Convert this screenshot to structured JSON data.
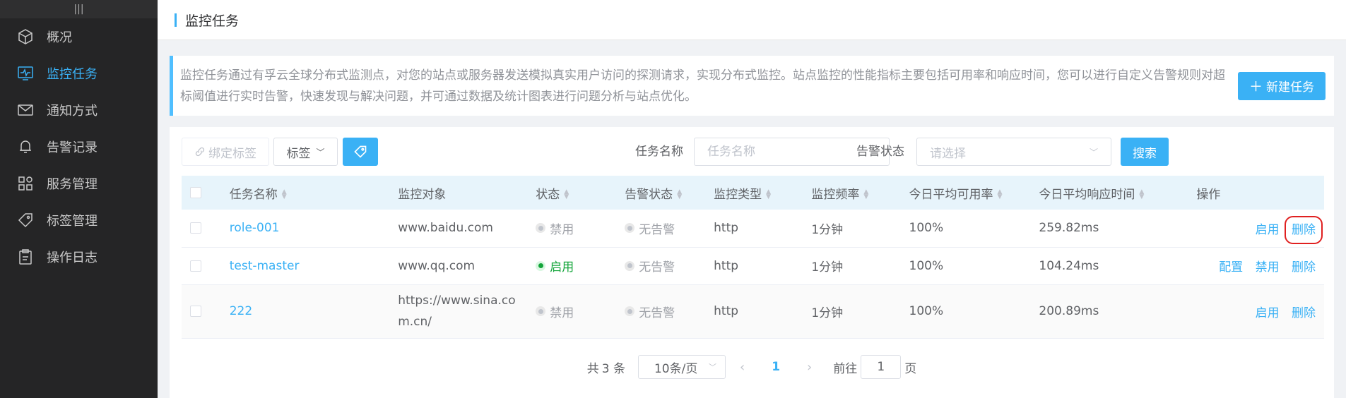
{
  "sidebar": {
    "toggle": "|||",
    "items": [
      {
        "label": "概况",
        "icon": "cube-icon",
        "active": false
      },
      {
        "label": "监控任务",
        "icon": "monitor-icon",
        "active": true
      },
      {
        "label": "通知方式",
        "icon": "envelope-icon",
        "active": false
      },
      {
        "label": "告警记录",
        "icon": "bell-icon",
        "active": false
      },
      {
        "label": "服务管理",
        "icon": "grid-icon",
        "active": false
      },
      {
        "label": "标签管理",
        "icon": "tag-icon",
        "active": false
      },
      {
        "label": "操作日志",
        "icon": "clipboard-icon",
        "active": false
      }
    ]
  },
  "header": {
    "title": "监控任务"
  },
  "notice": {
    "text": "监控任务通过有孚云全球分布式监测点，对您的站点或服务器发送模拟真实用户访问的探测请求，实现分布式监控。站点监控的性能指标主要包括可用率和响应时间，您可以进行自定义告警规则对超标阈值进行实时告警，快速发现与解决问题，并可通过数据及统计图表进行问题分析与站点优化。",
    "new_task_label": "新建任务"
  },
  "toolbar": {
    "bind_tag_label": "绑定标签",
    "tag_dropdown_label": "标签",
    "task_name_label": "任务名称",
    "task_name_placeholder": "任务名称",
    "alert_status_label": "告警状态",
    "alert_status_placeholder": "请选择",
    "search_label": "搜索"
  },
  "table": {
    "headers": [
      "任务名称",
      "监控对象",
      "状态",
      "告警状态",
      "监控类型",
      "监控频率",
      "今日平均可用率",
      "今日平均响应时间",
      "操作"
    ],
    "rows": [
      {
        "name": "role-001",
        "target": "www.baidu.com",
        "status": "禁用",
        "alert": "无告警",
        "type": "http",
        "freq": "1分钟",
        "availability": "100%",
        "response": "259.82ms",
        "actions": [
          "启用",
          "删除"
        ]
      },
      {
        "name": "test-master",
        "target": "www.qq.com",
        "status": "启用",
        "alert": "无告警",
        "type": "http",
        "freq": "1分钟",
        "availability": "100%",
        "response": "104.24ms",
        "actions": [
          "配置",
          "禁用",
          "删除"
        ]
      },
      {
        "name": "222",
        "target": "https://www.sina.com.cn/",
        "status": "禁用",
        "alert": "无告警",
        "type": "http",
        "freq": "1分钟",
        "availability": "100%",
        "response": "200.89ms",
        "actions": [
          "启用",
          "删除"
        ]
      }
    ]
  },
  "pagination": {
    "total_prefix": "共",
    "total": "3",
    "total_suffix": "条",
    "page_size": "10条/页",
    "current_page": "1",
    "goto_prefix": "前往",
    "goto_value": "1",
    "goto_suffix": "页"
  },
  "colors": {
    "accent": "#3ab1f5",
    "sidebar_bg": "#252526",
    "enabled": "#13a53a",
    "highlight": "#e02020"
  }
}
